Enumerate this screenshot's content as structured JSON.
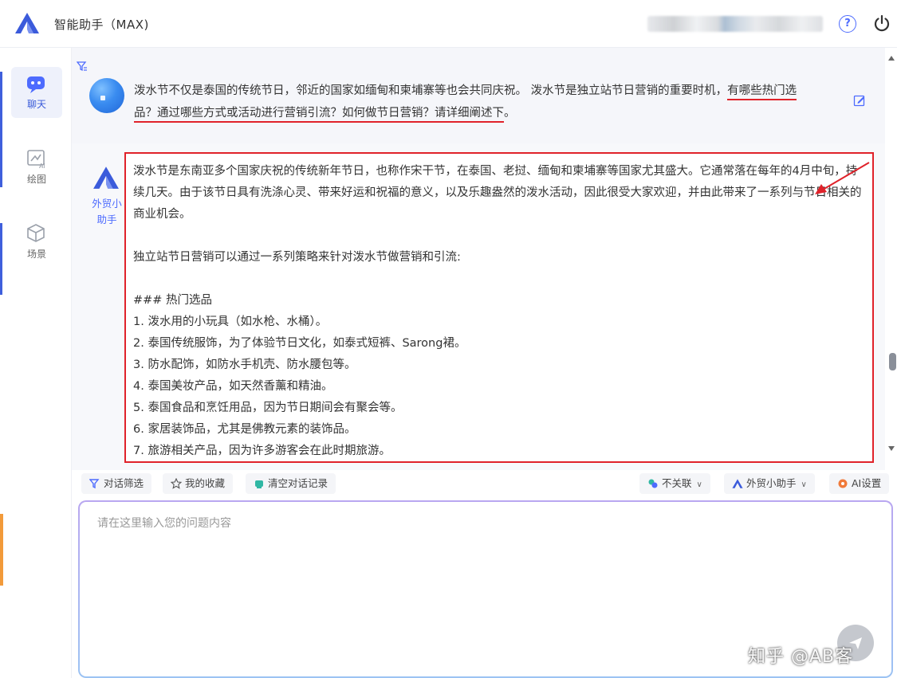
{
  "header": {
    "app_title": "智能助手（MAX)",
    "help_icon": "question-circle-icon",
    "power_icon": "power-icon"
  },
  "sidebar": {
    "items": [
      {
        "label": "聊天",
        "icon": "chat-icon",
        "active": true
      },
      {
        "label": "绘图",
        "icon": "drawing-icon",
        "active": false
      },
      {
        "label": "场景",
        "icon": "scene-icon",
        "active": false
      }
    ]
  },
  "chat": {
    "user_message": {
      "part1": "泼水节不仅是泰国的传统节日，邻近的国家如缅甸和柬埔寨等也会共同庆祝。 泼水节是独立站节日营销的重要时机，",
      "part2": "有哪些热门选",
      "part3": "品？通过哪些方式或活动进行营销引流？如何做节日营销？请详细阐述下",
      "part4": "。"
    },
    "assistant": {
      "name": "外贸小助手",
      "paragraphs": [
        "泼水节是东南亚多个国家庆祝的传统新年节日，也称作宋干节，在泰国、老挝、缅甸和柬埔寨等国家尤其盛大。它通常落在每年的4月中旬，持续几天。由于该节日具有洗涤心灵、带来好运和祝福的意义，以及乐趣盎然的泼水活动，因此很受大家欢迎，并由此带来了一系列与节日相关的商业机会。",
        "独立站节日营销可以通过一系列策略来针对泼水节做营销和引流:",
        "### 热门选品"
      ],
      "list": [
        "1. 泼水用的小玩具（如水枪、水桶）。",
        "2. 泰国传统服饰，为了体验节日文化，如泰式短裤、Sarong裙。",
        "3. 防水配饰，如防水手机壳、防水腰包等。",
        "4. 泰国美妆产品，如天然香薰和精油。",
        "5. 泰国食品和烹饪用品，因为节日期间会有聚会等。",
        "6. 家居装饰品，尤其是佛教元素的装饰品。",
        "7. 旅游相关产品，因为许多游客会在此时期旅游。"
      ]
    }
  },
  "toolbar": {
    "filter_label": "对话筛选",
    "favorites_label": "我的收藏",
    "clear_label": "清空对话记录",
    "context_label": "不关联",
    "assistant_label": "外贸小助手",
    "ai_settings_label": "AI设置"
  },
  "input": {
    "placeholder": "请在这里输入您的问题内容"
  },
  "watermark": "知乎 @AB客",
  "colors": {
    "accent": "#4d6bfe",
    "highlight_red": "#e0222a"
  }
}
